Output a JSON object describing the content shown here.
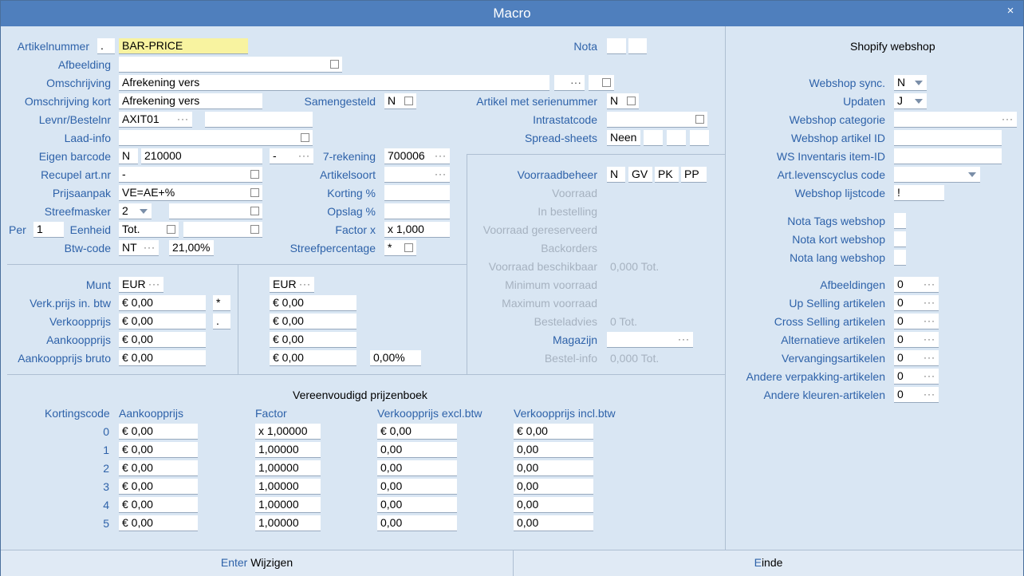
{
  "window": {
    "title": "Macro",
    "close": "×"
  },
  "labels": {
    "artikelnummer": "Artikelnummer",
    "afbeelding": "Afbeelding",
    "omschrijving": "Omschrijving",
    "omschrijving_kort": "Omschrijving kort",
    "levnr": "Levnr/Bestelnr",
    "laad_info": "Laad-info",
    "eigen_barcode": "Eigen barcode",
    "recupel": "Recupel art.nr",
    "prijsaanpak": "Prijsaanpak",
    "streefmasker": "Streefmasker",
    "per": "Per",
    "eenheid": "Eenheid",
    "btw_code": "Btw-code",
    "samengesteld": "Samengesteld",
    "zeven_rekening": "7-rekening",
    "artikelsoort": "Artikelsoort",
    "korting": "Korting %",
    "opslag": "Opslag  %",
    "factor": "Factor  x",
    "streefpercentage": "Streefpercentage",
    "nota": "Nota",
    "serienummer": "Artikel met serienummer",
    "intrastatcode": "Intrastatcode",
    "spread_sheets": "Spread-sheets",
    "munt": "Munt",
    "verkprijs_btw": "Verk.prijs in. btw",
    "verkoopprijs": "Verkoopprijs",
    "aankoopprijs": "Aankoopprijs",
    "aankoopprijs_bruto": "Aankoopprijs bruto",
    "voorraadbeheer": "Voorraadbeheer",
    "voorraad": "Voorraad",
    "in_bestelling": "In bestelling",
    "voorraad_gereserveerd": "Voorraad gereserveerd",
    "backorders": "Backorders",
    "voorraad_beschikbaar": "Voorraad beschikbaar",
    "minimum_voorraad": "Minimum voorraad",
    "maximum_voorraad": "Maximum voorraad",
    "besteladvies": "Besteladvies",
    "magazijn": "Magazijn",
    "bestel_info": "Bestel-info"
  },
  "fields": {
    "artikelnummer_prefix": ".",
    "artikelnummer": "BAR-PRICE",
    "omschrijving": "Afrekening vers",
    "omschrijving_dots": "···",
    "omschrijving_kort": "Afrekening vers",
    "levnr": "AXIT01",
    "barcode_type": "N",
    "barcode": "210000",
    "barcode_extra": "-",
    "recupel": "-",
    "prijsaanpak": "VE=AE+%",
    "streefmasker": "2",
    "per": "1",
    "eenheid": "Tot.",
    "btw_code": "NT",
    "btw_pct": "21,00%",
    "samengesteld": "N",
    "zeven_rekening": "700006",
    "factor": "x 1,000",
    "streefpercentage": "*",
    "serienummer": "N",
    "spread_sheets": "Neen",
    "voorraadbeheer": [
      "N",
      "GV",
      "PK",
      "PP"
    ],
    "voorraad_beschikbaar": "0,000 Tot.",
    "besteladvies": "0 Tot.",
    "bestel_info": "0,000 Tot.",
    "munt1": "EUR",
    "munt2": "EUR",
    "verkprijs_btw1": "€ 0,00",
    "verkprijs_btw_flag": "*",
    "verkoopprijs1": "€ 0,00",
    "verkoopprijs_flag": ".",
    "aankoopprijs1": "€ 0,00",
    "aankoopprijs_bruto1": "€ 0,00",
    "verkprijs_btw2": "€ 0,00",
    "verkoopprijs2": "€ 0,00",
    "aankoopprijs2": "€ 0,00",
    "aankoopprijs_bruto2": "€ 0,00",
    "aankoop_pct": "0,00%"
  },
  "prijzenboek": {
    "title": "Vereenvoudigd prijzenboek",
    "headers": [
      "Kortingscode",
      "Aankoopprijs",
      "Factor",
      "Verkoopprijs excl.btw",
      "Verkoopprijs incl.btw"
    ],
    "rows": [
      {
        "code": "0",
        "aankoop": "€ 0,00",
        "factor": "x 1,00000",
        "excl": "€ 0,00",
        "incl": "€ 0,00"
      },
      {
        "code": "1",
        "aankoop": "€ 0,00",
        "factor": "1,00000",
        "excl": "0,00",
        "incl": "0,00"
      },
      {
        "code": "2",
        "aankoop": "€ 0,00",
        "factor": "1,00000",
        "excl": "0,00",
        "incl": "0,00"
      },
      {
        "code": "3",
        "aankoop": "€ 0,00",
        "factor": "1,00000",
        "excl": "0,00",
        "incl": "0,00"
      },
      {
        "code": "4",
        "aankoop": "€ 0,00",
        "factor": "1,00000",
        "excl": "0,00",
        "incl": "0,00"
      },
      {
        "code": "5",
        "aankoop": "€ 0,00",
        "factor": "1,00000",
        "excl": "0,00",
        "incl": "0,00"
      }
    ]
  },
  "shopify": {
    "title": "Shopify webshop",
    "labels": {
      "sync": "Webshop sync.",
      "updaten": "Updaten",
      "categorie": "Webshop categorie",
      "artikel_id": "Webshop artikel ID",
      "inventaris_id": "WS Inventaris item-ID",
      "levenscyclus": "Art.levenscyclus code",
      "lijstcode": "Webshop lijstcode",
      "nota_tags": "Nota Tags webshop",
      "nota_kort": "Nota kort webshop",
      "nota_lang": "Nota lang webshop",
      "afbeeldingen": "Afbeeldingen",
      "up_selling": "Up Selling artikelen",
      "cross_selling": "Cross Selling artikelen",
      "alternatieve": "Alternatieve artikelen",
      "vervanging": "Vervangingsartikelen",
      "andere_verpakking": "Andere verpakking-artikelen",
      "andere_kleuren": "Andere kleuren-artikelen"
    },
    "values": {
      "sync": "N",
      "updaten": "J",
      "lijstcode": "!",
      "afbeeldingen": "0",
      "up_selling": "0",
      "cross_selling": "0",
      "alternatieve": "0",
      "vervanging": "0",
      "andere_verpakking": "0",
      "andere_kleuren": "0"
    }
  },
  "footer": {
    "left_key": "Enter",
    "left_label": " Wijzigen",
    "right_key": "E",
    "right_label": "inde"
  },
  "colors": {
    "title_bar": "#4f7fbd",
    "background": "#d9e6f3",
    "label": "#2e62a9",
    "highlight": "#f8f3a0"
  }
}
